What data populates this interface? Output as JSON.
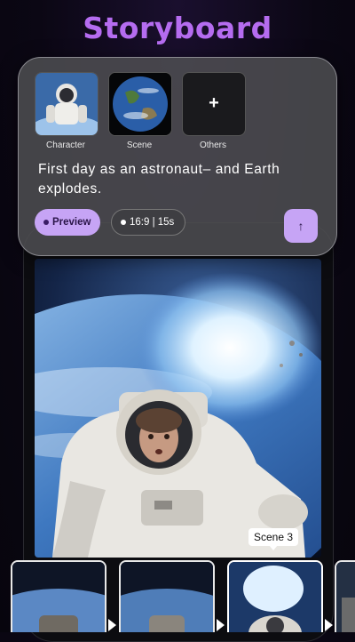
{
  "page": {
    "title": "Storyboard"
  },
  "assets": [
    {
      "label": "Character",
      "icon": "astronaut-thumbnail"
    },
    {
      "label": "Scene",
      "icon": "earth-thumbnail"
    },
    {
      "label": "Others",
      "icon": "plus-icon",
      "glyph": "+"
    }
  ],
  "prompt": {
    "text": "First day as an astronaut– and Earth explodes."
  },
  "controls": {
    "preview_label": "Preview",
    "ratio_label": "16:9 | 15s",
    "send_glyph": "↑"
  },
  "preview": {
    "scene_tag": "Scene 3"
  },
  "filmstrip": {
    "selected_index": 2,
    "frame_count": 4
  },
  "colors": {
    "title": "#b56cf0",
    "accent": "#c6a4f5"
  }
}
